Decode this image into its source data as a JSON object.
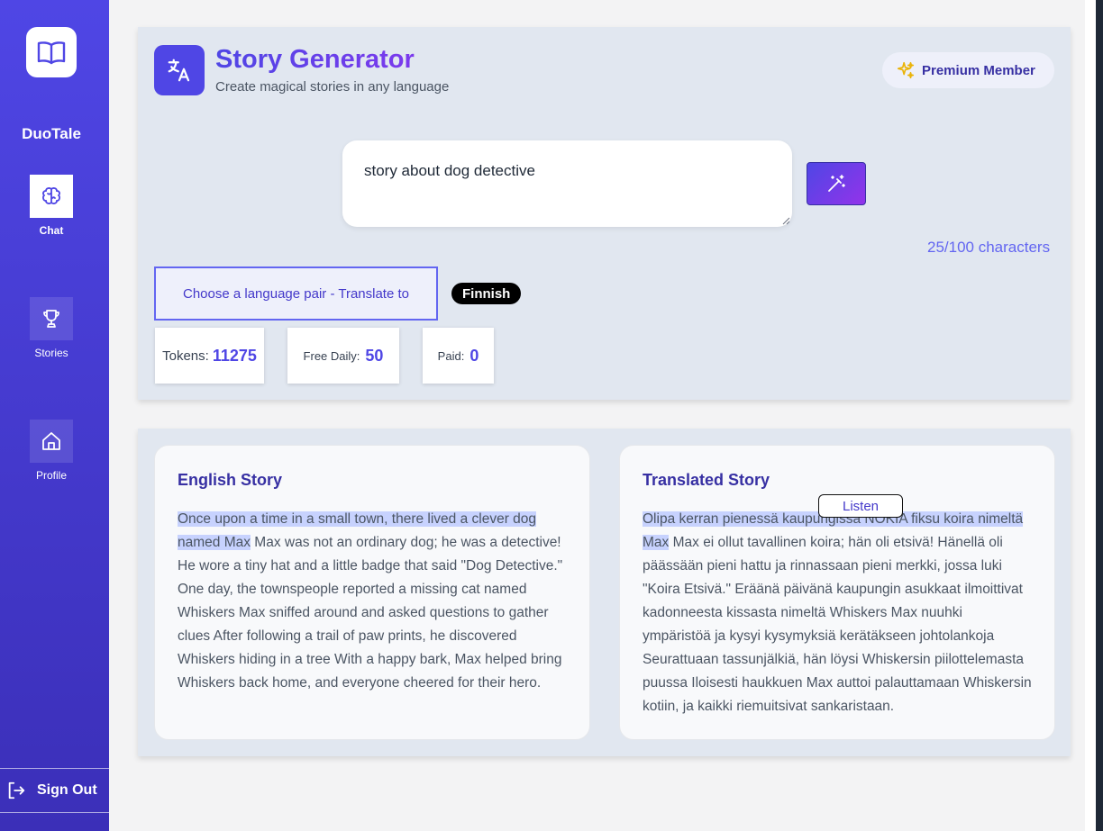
{
  "sidebar": {
    "brand": "DuoTale",
    "items": [
      {
        "label": "Chat",
        "icon": "brain-icon",
        "active": true
      },
      {
        "label": "Stories",
        "icon": "trophy-icon",
        "active": false
      },
      {
        "label": "Profile",
        "icon": "home-icon",
        "active": false
      }
    ],
    "signout_label": "Sign Out"
  },
  "header": {
    "title": "Story Generator",
    "subtitle": "Create magical stories in any language",
    "premium_label": "Premium Member"
  },
  "prompt": {
    "value": "story about dog detective",
    "char_count": "25/100 characters"
  },
  "language": {
    "pair_label": "Choose a language pair - Translate to",
    "selected": "Finnish"
  },
  "stats": {
    "tokens_label": "Tokens:",
    "tokens_value": "11275",
    "free_label": "Free Daily:",
    "free_value": "50",
    "paid_label": "Paid:",
    "paid_value": "0"
  },
  "stories": {
    "english": {
      "title": "English Story",
      "highlight": "Once upon a time in a small town, there lived a clever dog named Max",
      "rest": " Max was not an ordinary dog; he was a detective! He wore a tiny hat and a little badge that said \"Dog Detective.\" One day, the townspeople reported a missing cat named Whiskers Max sniffed around and asked questions to gather clues After following a trail of paw prints, he discovered Whiskers hiding in a tree With a happy bark, Max helped bring Whiskers back home, and everyone cheered for their hero."
    },
    "translated": {
      "title": "Translated Story",
      "listen_label": "Listen",
      "highlight": "Olipa kerran pienessä kaupungissa NOKIA fiksu koira nimeltä Max",
      "rest": " Max ei ollut tavallinen koira; hän oli etsivä! Hänellä oli päässään pieni hattu ja rinnassaan pieni merkki, jossa luki \"Koira Etsivä.\" Eräänä päivänä kaupungin asukkaat ilmoittivat kadonneesta kissasta nimeltä Whiskers Max nuuhki ympäristöä ja kysyi kysymyksiä kerätäkseen johtolankoja Seurattuaan tassunjälkiä, hän löysi Whiskersin piilottelemasta puussa Iloisesti haukkuen Max auttoi palauttamaan Whiskersin kotiin, ja kaikki riemuitsivat sankaristaan."
    }
  },
  "colors": {
    "accent": "#4f46e5",
    "highlight": "#c7d2fe",
    "sidebar": "#4338ca"
  }
}
